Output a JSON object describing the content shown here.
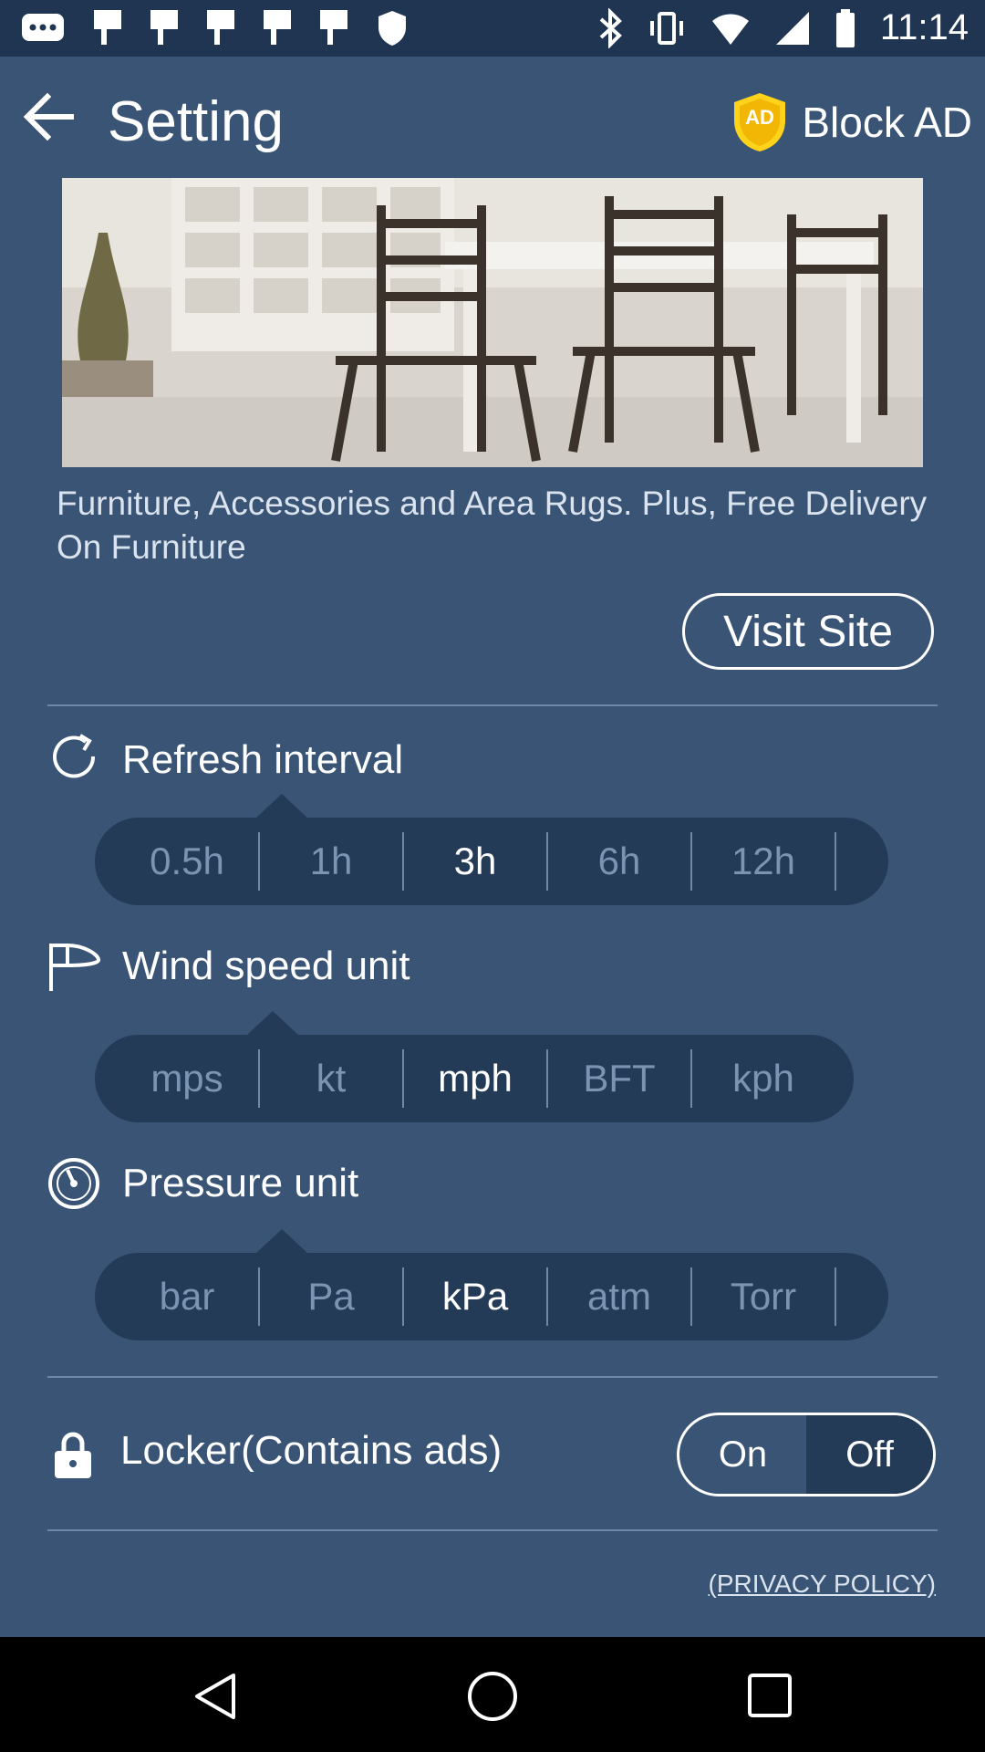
{
  "status_bar": {
    "time": "11:14"
  },
  "header": {
    "title": "Setting",
    "block_ad_label": "Block AD",
    "block_ad_badge": "AD"
  },
  "ad": {
    "text": "Furniture, Accessories and Area Rugs. Plus, Free Delivery On Furniture",
    "button_label": "Visit Site"
  },
  "settings": {
    "refresh": {
      "title": "Refresh interval",
      "options": [
        "0.5h",
        "1h",
        "3h",
        "6h",
        "12h"
      ],
      "selected": "3h"
    },
    "wind": {
      "title": "Wind speed unit",
      "options": [
        "mps",
        "kt",
        "mph",
        "BFT",
        "kph"
      ],
      "selected": "mph"
    },
    "pressure": {
      "title": "Pressure unit",
      "options": [
        "bar",
        "Pa",
        "kPa",
        "atm",
        "Torr"
      ],
      "selected": "kPa"
    }
  },
  "locker": {
    "label": "Locker(Contains ads)",
    "on_label": "On",
    "off_label": "Off",
    "state": "Off"
  },
  "footer": {
    "privacy_label": "(PRIVACY POLICY)"
  },
  "icons": {
    "back": "arrow-left-icon",
    "shield": "shield-ad-icon",
    "refresh": "refresh-icon",
    "wind": "windsock-icon",
    "pressure": "gauge-icon",
    "lock": "lock-icon"
  },
  "colors": {
    "background": "#395475",
    "segment": "#243b58",
    "muted": "#7b94b2",
    "statusbar": "#1f3552"
  }
}
